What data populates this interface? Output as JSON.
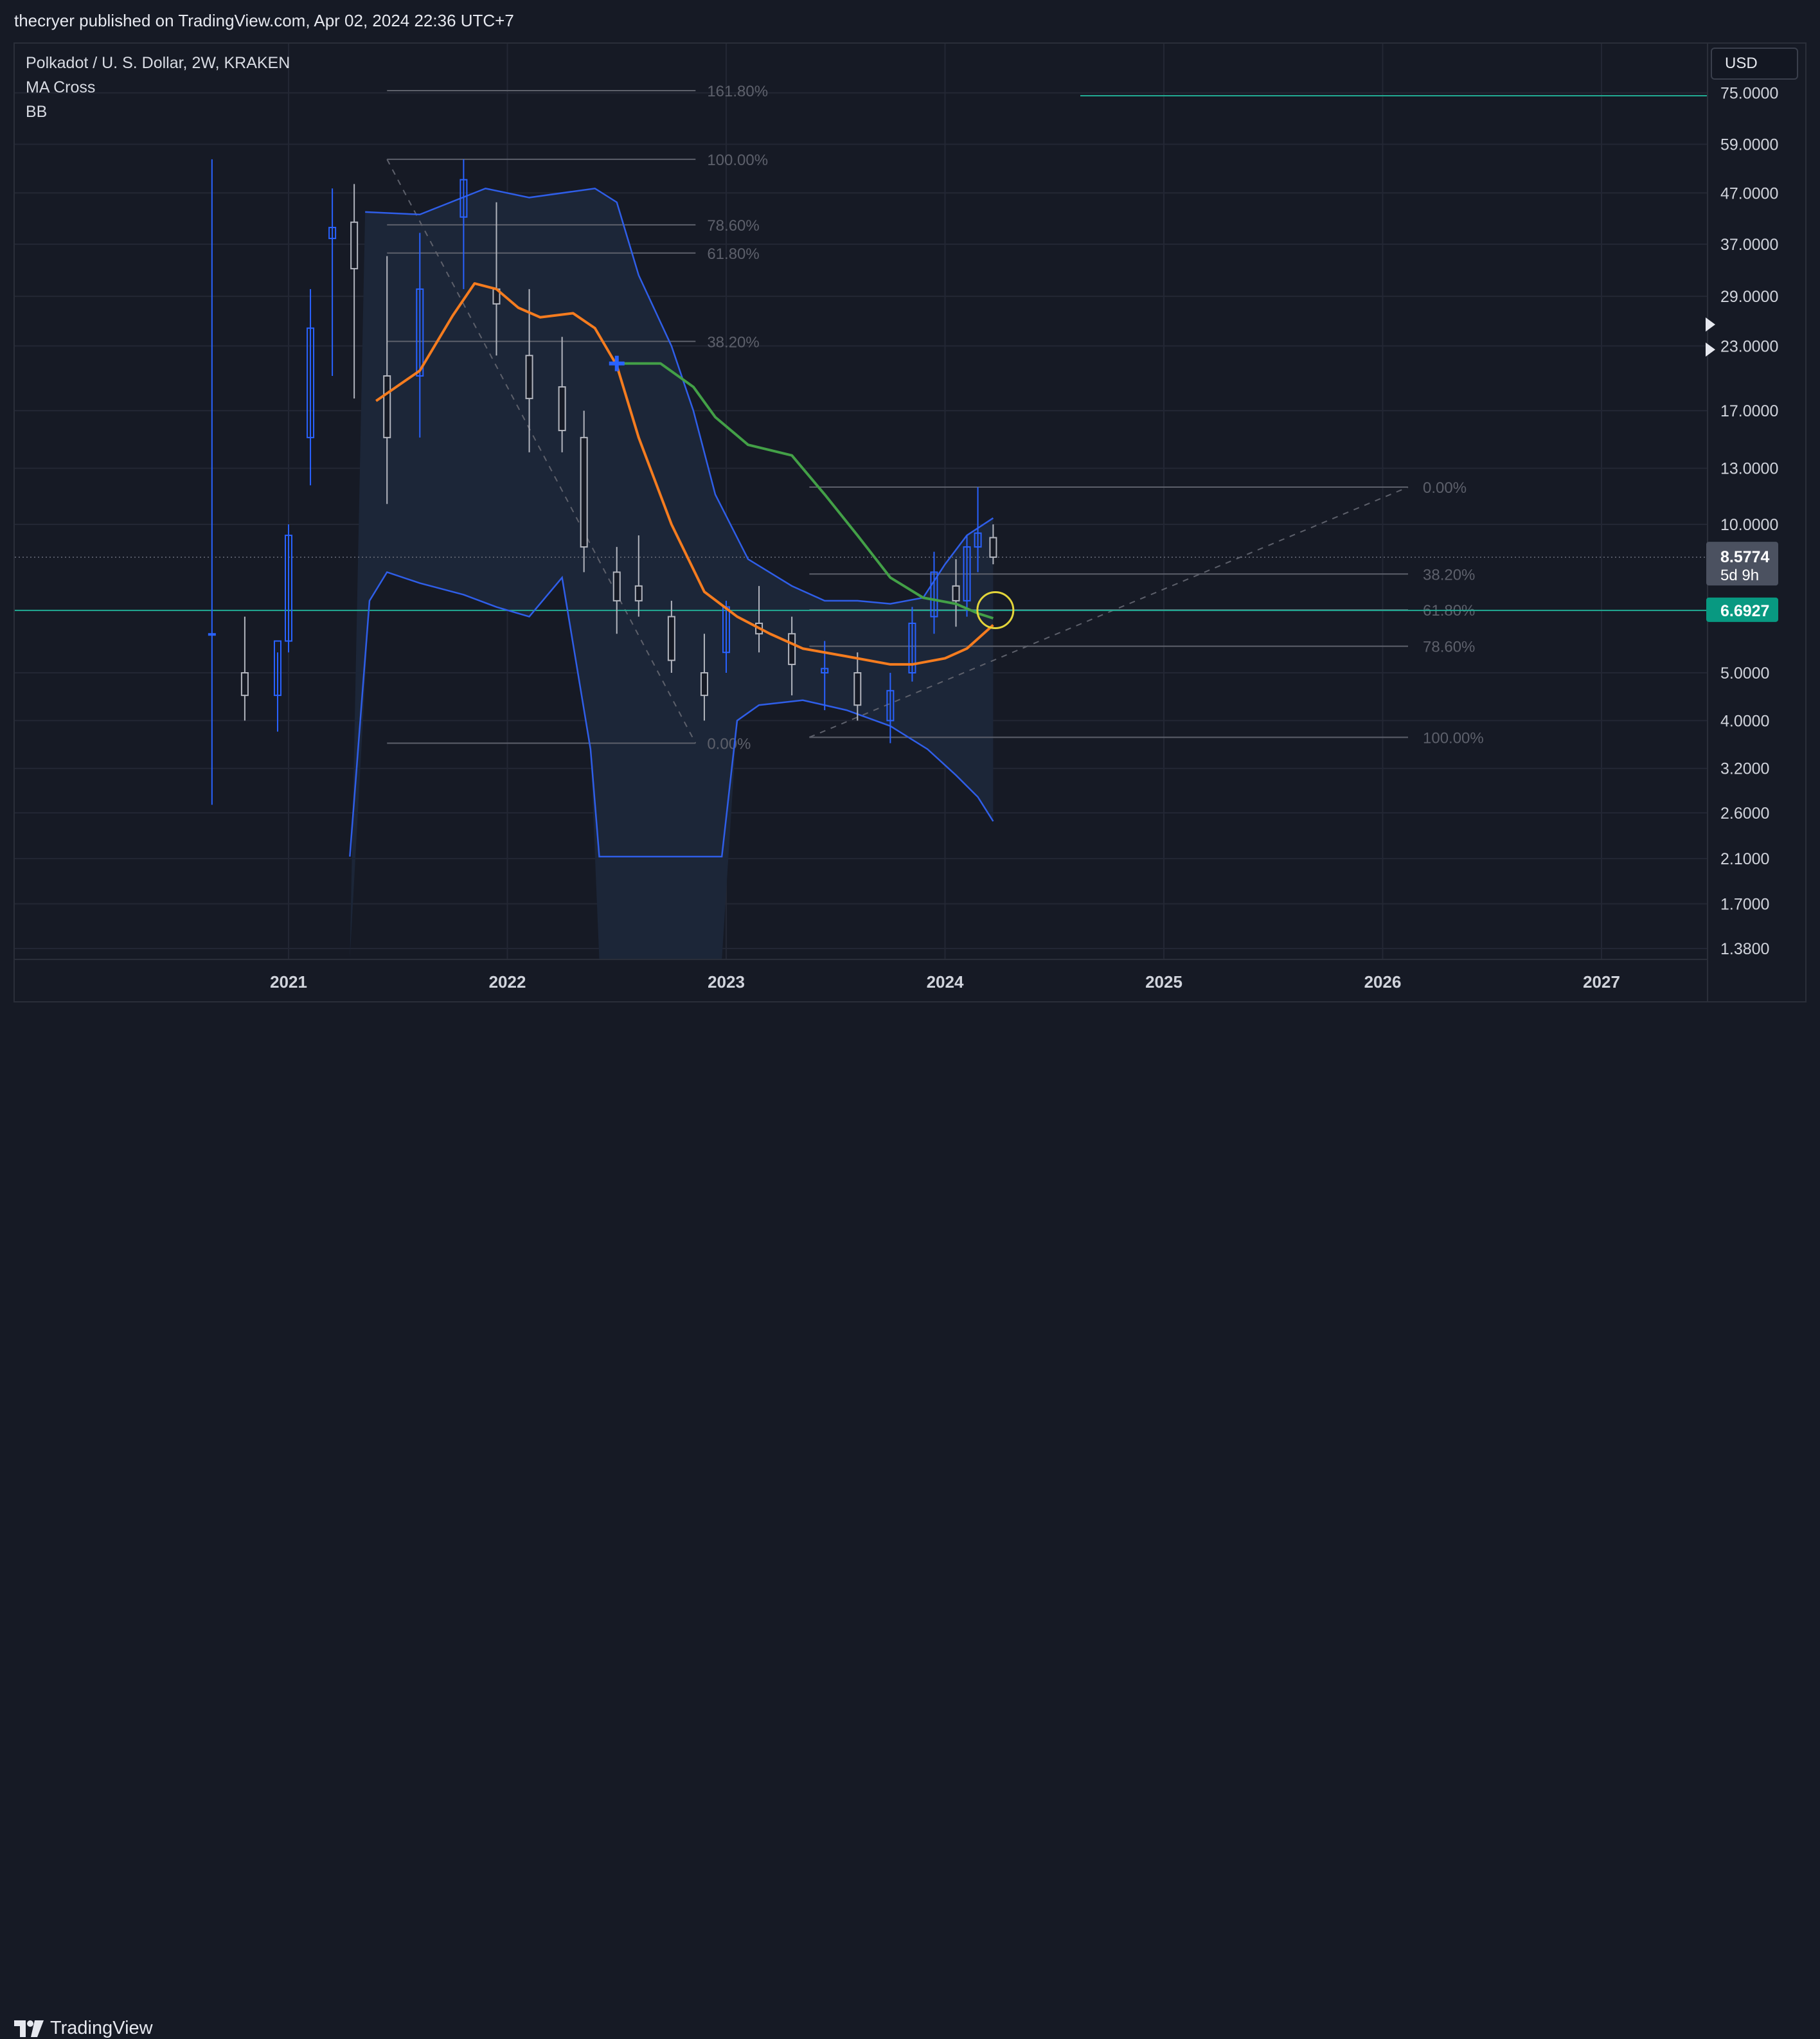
{
  "header": {
    "published": "thecryer published on TradingView.com, Apr 02, 2024 22:36 UTC+7"
  },
  "legend": {
    "symbol": "Polkadot / U. S. Dollar, 2W, KRAKEN",
    "indicator1": "MA Cross",
    "indicator2": "BB"
  },
  "currency_button": "USD",
  "footer": {
    "brand": "TradingView"
  },
  "colors": {
    "background": "#161a25",
    "ma_fast": "#f57c1f",
    "ma_slow": "#43a047",
    "bb": "#2f5ee8",
    "candle_up": "#2962ff",
    "candle_down": "#b2b5be",
    "current_price": "#22ab94",
    "highlight_circle": "#e3d53a"
  },
  "chart_data": {
    "type": "candlestick",
    "title": "Polkadot / U. S. Dollar, 2W, KRAKEN",
    "x_ticks": [
      "2021",
      "2022",
      "2023",
      "2024",
      "2025",
      "2026",
      "2027"
    ],
    "y_scale": "log",
    "y_ticks": [
      "75.0000",
      "59.0000",
      "47.0000",
      "37.0000",
      "29.0000",
      "23.0000",
      "17.0000",
      "13.0000",
      "10.0000",
      "5.0000",
      "4.0000",
      "3.2000",
      "2.6000",
      "2.1000",
      "1.7000",
      "1.3800"
    ],
    "last_price": {
      "value": "8.5774",
      "countdown": "5d 9h"
    },
    "current_line": {
      "value": "6.6927"
    },
    "fib_retracement_1": {
      "from": 55.0,
      "to": 3.6,
      "levels": [
        {
          "label": "161.80%",
          "value": 75.8
        },
        {
          "label": "100.00%",
          "value": 55.0
        },
        {
          "label": "78.60%",
          "value": 40.5
        },
        {
          "label": "61.80%",
          "value": 35.5
        },
        {
          "label": "38.20%",
          "value": 23.5
        },
        {
          "label": "0.00%",
          "value": 3.6
        }
      ]
    },
    "fib_retracement_2": {
      "from": 11.9,
      "to": 3.7,
      "levels": [
        {
          "label": "0.00%",
          "value": 11.9
        },
        {
          "label": "38.20%",
          "value": 7.93
        },
        {
          "label": "61.80%",
          "value": 6.71
        },
        {
          "label": "78.60%",
          "value": 5.66
        },
        {
          "label": "100.00%",
          "value": 3.7
        }
      ]
    },
    "ma_fast": [
      [
        2021.4,
        17.8
      ],
      [
        2021.6,
        20.5
      ],
      [
        2021.75,
        26.5
      ],
      [
        2021.85,
        30.8
      ],
      [
        2021.95,
        30.0
      ],
      [
        2022.05,
        27.5
      ],
      [
        2022.15,
        26.3
      ],
      [
        2022.3,
        26.8
      ],
      [
        2022.4,
        25.0
      ],
      [
        2022.5,
        21.0
      ],
      [
        2022.6,
        15.0
      ],
      [
        2022.75,
        10.0
      ],
      [
        2022.9,
        7.3
      ],
      [
        2023.05,
        6.5
      ],
      [
        2023.2,
        6.0
      ],
      [
        2023.35,
        5.6
      ],
      [
        2023.55,
        5.4
      ],
      [
        2023.75,
        5.2
      ],
      [
        2023.85,
        5.2
      ],
      [
        2024.0,
        5.35
      ],
      [
        2024.1,
        5.6
      ],
      [
        2024.22,
        6.25
      ]
    ],
    "ma_slow": [
      [
        2022.5,
        21.2
      ],
      [
        2022.7,
        21.2
      ],
      [
        2022.85,
        19.0
      ],
      [
        2022.95,
        16.5
      ],
      [
        2023.1,
        14.5
      ],
      [
        2023.3,
        13.8
      ],
      [
        2023.45,
        11.5
      ],
      [
        2023.6,
        9.5
      ],
      [
        2023.75,
        7.8
      ],
      [
        2023.9,
        7.1
      ],
      [
        2024.05,
        6.9
      ],
      [
        2024.15,
        6.6
      ],
      [
        2024.22,
        6.45
      ]
    ],
    "bb_upper": [
      [
        2021.35,
        43
      ],
      [
        2021.6,
        42.5
      ],
      [
        2021.9,
        48
      ],
      [
        2022.1,
        46
      ],
      [
        2022.4,
        48
      ],
      [
        2022.5,
        45
      ],
      [
        2022.6,
        32
      ],
      [
        2022.75,
        23
      ],
      [
        2022.85,
        17
      ],
      [
        2022.95,
        11.5
      ],
      [
        2023.1,
        8.5
      ],
      [
        2023.3,
        7.5
      ],
      [
        2023.45,
        7.0
      ],
      [
        2023.6,
        7.0
      ],
      [
        2023.75,
        6.9
      ],
      [
        2023.9,
        7.1
      ],
      [
        2024.0,
        8.3
      ],
      [
        2024.1,
        9.5
      ],
      [
        2024.22,
        10.3
      ]
    ],
    "bb_lower": [
      [
        2021.28,
        1.28
      ],
      [
        2021.37,
        7.0
      ],
      [
        2021.45,
        8.0
      ],
      [
        2021.6,
        7.6
      ],
      [
        2021.8,
        7.2
      ],
      [
        2021.95,
        6.8
      ],
      [
        2022.1,
        6.5
      ],
      [
        2022.25,
        7.8
      ],
      [
        2022.38,
        3.5
      ],
      [
        2022.42,
        1.28
      ],
      [
        2022.98,
        1.28
      ],
      [
        2023.05,
        4.0
      ],
      [
        2023.15,
        4.3
      ],
      [
        2023.35,
        4.4
      ],
      [
        2023.55,
        4.2
      ],
      [
        2023.75,
        3.9
      ],
      [
        2023.92,
        3.5
      ],
      [
        2024.05,
        3.1
      ],
      [
        2024.15,
        2.8
      ],
      [
        2024.22,
        2.5
      ]
    ],
    "candles_summary": [
      [
        2020.65,
        6.0,
        55.0,
        2.7,
        6.0
      ],
      [
        2020.8,
        5.0,
        6.5,
        4.0,
        4.5
      ],
      [
        2020.95,
        4.5,
        5.5,
        3.8,
        5.8
      ],
      [
        2021.0,
        5.8,
        10.0,
        5.5,
        9.5
      ],
      [
        2021.1,
        15.0,
        30.0,
        12.0,
        25.0
      ],
      [
        2021.2,
        38.0,
        48.0,
        20.0,
        40.0
      ],
      [
        2021.3,
        41.0,
        49.0,
        18.0,
        33.0
      ],
      [
        2021.45,
        20.0,
        35.0,
        11.0,
        15.0
      ],
      [
        2021.6,
        20.0,
        39.0,
        15.0,
        30.0
      ],
      [
        2021.8,
        42.0,
        55.0,
        30.0,
        50.0
      ],
      [
        2021.95,
        30.0,
        45.0,
        22.0,
        28.0
      ],
      [
        2022.1,
        22.0,
        30.0,
        14.0,
        18.0
      ],
      [
        2022.25,
        19.0,
        24.0,
        14.0,
        15.5
      ],
      [
        2022.35,
        15.0,
        17.0,
        8.0,
        9.0
      ],
      [
        2022.5,
        8.0,
        9.0,
        6.0,
        7.0
      ],
      [
        2022.6,
        7.5,
        9.5,
        6.5,
        7.0
      ],
      [
        2022.75,
        6.5,
        7.0,
        5.0,
        5.3
      ],
      [
        2022.9,
        5.0,
        6.0,
        4.0,
        4.5
      ],
      [
        2023.0,
        5.5,
        7.0,
        5.0,
        6.8
      ],
      [
        2023.15,
        6.3,
        7.5,
        5.5,
        6.0
      ],
      [
        2023.3,
        6.0,
        6.5,
        4.5,
        5.2
      ],
      [
        2023.45,
        5.0,
        5.8,
        4.2,
        5.1
      ],
      [
        2023.6,
        5.0,
        5.5,
        4.0,
        4.3
      ],
      [
        2023.75,
        4.0,
        5.0,
        3.6,
        4.6
      ],
      [
        2023.85,
        5.0,
        6.8,
        4.8,
        6.3
      ],
      [
        2023.95,
        6.5,
        8.8,
        6.0,
        8.0
      ],
      [
        2024.05,
        7.5,
        8.5,
        6.2,
        7.0
      ],
      [
        2024.1,
        7.0,
        9.5,
        6.5,
        9.0
      ],
      [
        2024.15,
        9.0,
        11.9,
        8.0,
        9.6
      ],
      [
        2024.22,
        9.4,
        10.0,
        8.3,
        8.58
      ]
    ]
  }
}
